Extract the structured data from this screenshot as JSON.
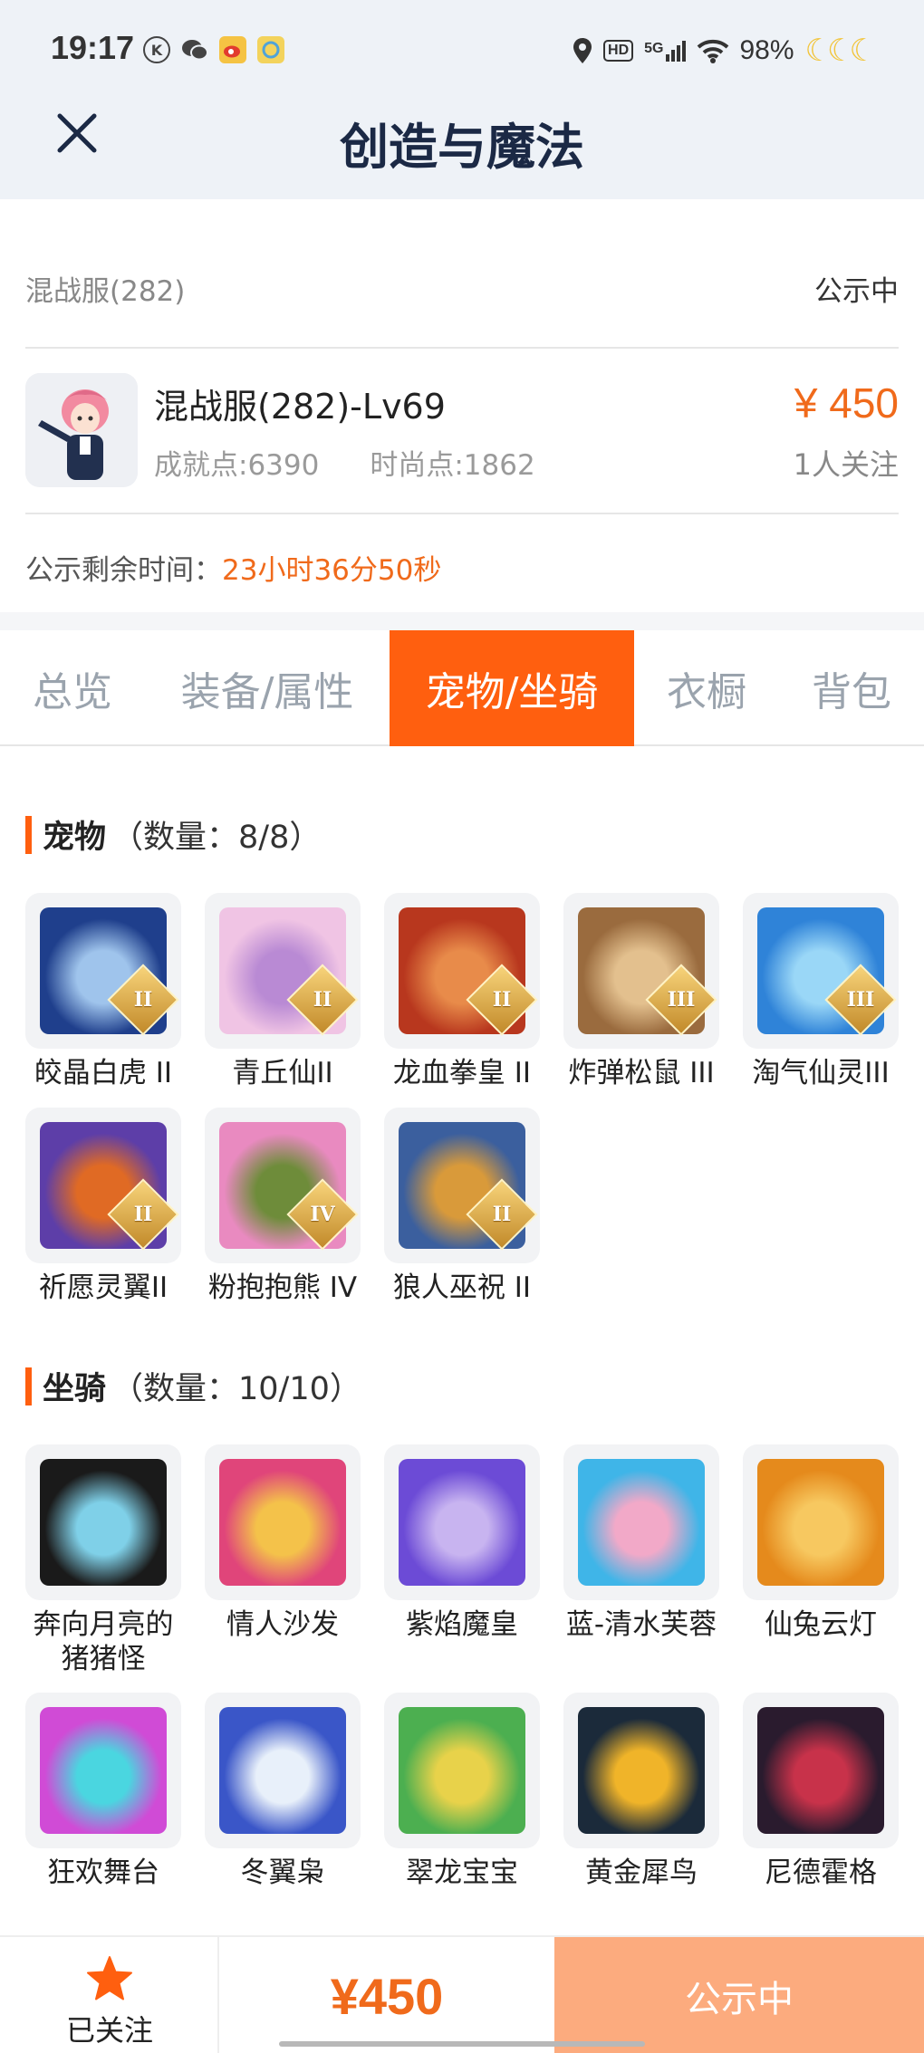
{
  "status_bar": {
    "time": "19:17",
    "battery": "98%",
    "icons": [
      "k-icon",
      "wechat-icon",
      "weibo-icon",
      "app-icon",
      "location-icon",
      "hd-icon",
      "5g-signal-icon",
      "wifi-icon",
      "moon-icon"
    ],
    "hd_label": "HD",
    "network_label": "5G"
  },
  "header": {
    "title": "创造与魔法",
    "close_icon": "close-icon"
  },
  "listing": {
    "server": "混战服(282)",
    "status": "公示中",
    "character_name": "混战服(282)-Lv69",
    "achievement": "成就点:6390",
    "fashion": "时尚点:1862",
    "price": "¥ 450",
    "followers": "1人关注",
    "remaining_label": "公示剩余时间：",
    "remaining_value": "23小时36分50秒"
  },
  "tabs": [
    {
      "label": "总览",
      "active": false
    },
    {
      "label": "装备/属性",
      "active": false
    },
    {
      "label": "宠物/坐骑",
      "active": true
    },
    {
      "label": "衣橱",
      "active": false
    },
    {
      "label": "背包",
      "active": false
    }
  ],
  "pets": {
    "title": "宠物",
    "count": "（数量：8/8）",
    "items": [
      {
        "name": "皎晶白虎 II",
        "rank": "II",
        "colors": [
          "#1f3f8c",
          "#9fc4ec"
        ]
      },
      {
        "name": "青丘仙II",
        "rank": "II",
        "colors": [
          "#f0c4e4",
          "#b98ad4"
        ]
      },
      {
        "name": "龙血拳皇 II",
        "rank": "II",
        "colors": [
          "#b8371e",
          "#e88b4a"
        ]
      },
      {
        "name": "炸弹松鼠 III",
        "rank": "III",
        "colors": [
          "#9a6b3e",
          "#e3c08e"
        ]
      },
      {
        "name": "淘气仙灵III",
        "rank": "III",
        "colors": [
          "#2f83d8",
          "#9ad7f7"
        ]
      },
      {
        "name": "祈愿灵翼II",
        "rank": "II",
        "colors": [
          "#5d3ea8",
          "#e06a24"
        ]
      },
      {
        "name": "粉抱抱熊 IV",
        "rank": "IV",
        "colors": [
          "#e98ac0",
          "#6e8c3a"
        ]
      },
      {
        "name": "狼人巫祝 II",
        "rank": "II",
        "colors": [
          "#3b5f9e",
          "#d99a3a"
        ]
      }
    ]
  },
  "mounts": {
    "title": "坐骑",
    "count": "（数量：10/10）",
    "items": [
      {
        "name": "奔向月亮的猪猪怪",
        "colors": [
          "#1a1a1a",
          "#7fd0e8"
        ]
      },
      {
        "name": "情人沙发",
        "colors": [
          "#e0457a",
          "#f4c24a"
        ]
      },
      {
        "name": "紫焰魔皇",
        "colors": [
          "#6c4bd6",
          "#c8b4f0"
        ]
      },
      {
        "name": "蓝-清水芙蓉",
        "colors": [
          "#3fb5e8",
          "#f2a9c8"
        ]
      },
      {
        "name": "仙兔云灯",
        "colors": [
          "#e58a1c",
          "#f7c860"
        ]
      },
      {
        "name": "狂欢舞台",
        "colors": [
          "#d04bd6",
          "#4ad6e0"
        ]
      },
      {
        "name": "冬翼枭",
        "colors": [
          "#3a56c8",
          "#e8f0fa"
        ]
      },
      {
        "name": "翠龙宝宝",
        "colors": [
          "#4caf50",
          "#e8d24a"
        ]
      },
      {
        "name": "黄金犀鸟",
        "colors": [
          "#1b2a3a",
          "#f0b429"
        ]
      },
      {
        "name": "尼德霍格",
        "colors": [
          "#2a1b2e",
          "#c8324a"
        ]
      }
    ]
  },
  "bottom_bar": {
    "follow_label": "已关注",
    "price": "¥450",
    "status": "公示中"
  },
  "colors": {
    "accent": "#ff5f0f",
    "price": "#f06a1b",
    "status_button": "#fcab7e"
  }
}
